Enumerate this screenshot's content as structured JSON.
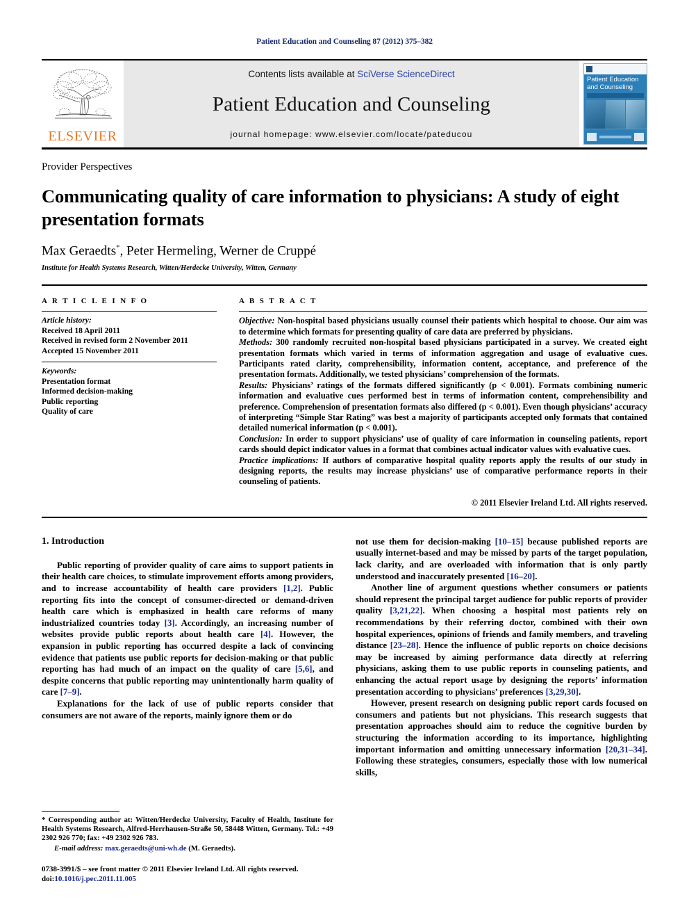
{
  "running_head": "Patient Education and Counseling 87 (2012) 375–382",
  "masthead": {
    "publisher_wordmark": "ELSEVIER",
    "contents_prefix": "Contents lists available at ",
    "contents_link": "SciVerse ScienceDirect",
    "journal_title": "Patient Education and Counseling",
    "homepage": "journal homepage: www.elsevier.com/locate/pateducou",
    "cover_title_line1": "Patient Education",
    "cover_title_line2": "and Counseling",
    "link_color": "#2b40a8"
  },
  "article": {
    "section_label": "Provider Perspectives",
    "title": "Communicating quality of care information to physicians: A study of eight presentation formats",
    "authors": "Max Geraedts",
    "author_mark": "*",
    "authors_rest": ", Peter Hermeling, Werner de Cruppé",
    "affiliation": "Institute for Health Systems Research, Witten/Herdecke University, Witten, Germany"
  },
  "article_info": {
    "heading": "A R T I C L E   I N F O",
    "history_label": "Article history:",
    "history": [
      "Received 18 April 2011",
      "Received in revised form 2 November 2011",
      "Accepted 15 November 2011"
    ],
    "keywords_label": "Keywords:",
    "keywords": [
      "Presentation format",
      "Informed decision-making",
      "Public reporting",
      "Quality of care"
    ]
  },
  "abstract": {
    "heading": "A B S T R A C T",
    "objective_label": "Objective:",
    "objective_text": " Non-hospital based physicians usually counsel their patients which hospital to choose. Our aim was to determine which formats for presenting quality of care data are preferred by physicians.",
    "methods_label": "Methods:",
    "methods_text": " 300 randomly recruited non-hospital based physicians participated in a survey. We created eight presentation formats which varied in terms of information aggregation and usage of evaluative cues. Participants rated clarity, comprehensibility, information content, acceptance, and preference of the presentation formats. Additionally, we tested physicians’ comprehension of the formats.",
    "results_label": "Results:",
    "results_text": " Physicians’ ratings of the formats differed significantly (p < 0.001). Formats combining numeric information and evaluative cues performed best in terms of information content, comprehensibility and preference. Comprehension of presentation formats also differed (p < 0.001). Even though physicians’ accuracy of interpreting “Simple Star Rating” was best a majority of participants accepted only formats that contained detailed numerical information (p < 0.001).",
    "conclusion_label": "Conclusion:",
    "conclusion_text": " In order to support physicians’ use of quality of care information in counseling patients, report cards should depict indicator values in a format that combines actual indicator values with evaluative cues.",
    "practice_label": "Practice implications:",
    "practice_text": " If authors of comparative hospital quality reports apply the results of our study in designing reports, the results may increase physicians’ use of comparative performance reports in their counseling of patients.",
    "copyright": "© 2011 Elsevier Ireland Ltd. All rights reserved."
  },
  "body": {
    "intro_heading": "1. Introduction",
    "left_para_1": "Public reporting of provider quality of care aims to support patients in their health care choices, to stimulate improvement efforts among providers, and to increase accountability of health care providers [1,2]. Public reporting fits into the concept of consumer-directed or demand-driven health care which is emphasized in health care reforms of many industrialized countries today [3]. Accordingly, an increasing number of websites provide public reports about health care [4]. However, the expansion in public reporting has occurred despite a lack of convincing evidence that patients use public reports for decision-making or that public reporting has had much of an impact on the quality of care [5,6], and despite concerns that public reporting may unintentionally harm quality of care [7–9].",
    "left_para_2": "Explanations for the lack of use of public reports consider that consumers are not aware of the reports, mainly ignore them or do",
    "right_para_1": "not use them for decision-making [10–15] because published reports are usually internet-based and may be missed by parts of the target population, lack clarity, and are overloaded with information that is only partly understood and inaccurately presented [16–20].",
    "right_para_2": "Another line of argument questions whether consumers or patients should represent the principal target audience for public reports of provider quality [3,21,22]. When choosing a hospital most patients rely on recommendations by their referring doctor, combined with their own hospital experiences, opinions of friends and family members, and traveling distance [23–28]. Hence the influence of public reports on choice decisions may be increased by aiming performance data directly at referring physicians, asking them to use public reports in counseling patients, and enhancing the actual report usage by designing the reports’ information presentation according to physicians’ preferences [3,29,30].",
    "right_para_3": "However, present research on designing public report cards focused on consumers and patients but not physicians. This research suggests that presentation approaches should aim to reduce the cognitive burden by structuring the information according to its importance, highlighting important information and omitting unnecessary information [20,31–34]. Following these strategies, consumers, especially those with low numerical skills,"
  },
  "footnotes": {
    "corresponding": "* Corresponding author at: Witten/Herdecke University, Faculty of Health, Institute for Health Systems Research, Alfred-Herrhausen-Straße 50, 58448 Witten, Germany. Tel.: +49 2302 926 770; fax: +49 2302 926 783.",
    "email_label": "E-mail address:",
    "email": "max.geraedts@uni-wh.de",
    "email_suffix": " (M. Geraedts).",
    "issn_line": "0738-3991/$ – see front matter © 2011 Elsevier Ireland Ltd. All rights reserved.",
    "doi_label": "doi:",
    "doi": "10.1016/j.pec.2011.11.005"
  }
}
